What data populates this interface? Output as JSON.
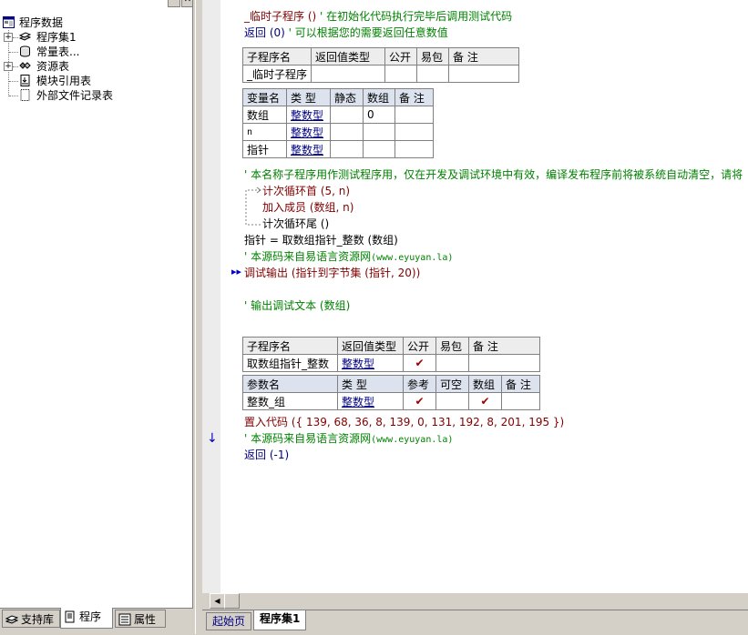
{
  "tree": {
    "root_label": "程序数据",
    "items": [
      {
        "label": "程序集1",
        "icon": "book-stack-icon",
        "expander": "+"
      },
      {
        "label": "常量表...",
        "icon": "database-icon",
        "expander": ""
      },
      {
        "label": "资源表",
        "icon": "resources-icon",
        "expander": "+"
      },
      {
        "label": "模块引用表",
        "icon": "module-ref-icon",
        "expander": ""
      },
      {
        "label": "外部文件记录表",
        "icon": "file-record-icon",
        "expander": ""
      }
    ]
  },
  "left_tabs": [
    {
      "label": "支持库",
      "icon": "library-icon"
    },
    {
      "label": "程序",
      "icon": "program-icon"
    },
    {
      "label": "属性",
      "icon": "properties-icon"
    }
  ],
  "code": {
    "line1_kw": "_临时子程序 ()",
    "line1_cm": "' 在初始化代码执行完毕后调用测试代码",
    "line2_kw": "返回 (0)",
    "line2_cm": "' 可以根据您的需要返回任意数值",
    "sub1_headers": [
      "子程序名",
      "返回值类型",
      "公开",
      "易包",
      "备 注"
    ],
    "sub1_row": [
      "_临时子程序",
      "",
      "",
      "",
      ""
    ],
    "var_headers": [
      "变量名",
      "类 型",
      "静态",
      "数组",
      "备 注"
    ],
    "vars": [
      {
        "name": "数组",
        "type": "整数型",
        "static": "",
        "array": "0",
        "note": ""
      },
      {
        "name": "n",
        "type": "整数型",
        "static": "",
        "array": "",
        "note": ""
      },
      {
        "name": "指针",
        "type": "整数型",
        "static": "",
        "array": "",
        "note": ""
      }
    ],
    "comment_long": "' 本名称子程序用作测试程序用，仅在开发及调试环境中有效，编译发布程序前将被系统自动清空，请将",
    "loop_head": "计次循环首 (5, n)",
    "loop_body": "加入成员 (数组, n)",
    "loop_tail": "计次循环尾 ()",
    "assign": "指针 = 取数组指针_整数 (数组)",
    "source_comment_prefix": "' 本源码来自易语言资源网",
    "source_comment_url": "(www.eyuyan.la)",
    "debug_output": "调试输出 (指针到字节集 (指针, 20))",
    "debug_text_comment": "' 输出调试文本 (数组)",
    "sub2_headers": [
      "子程序名",
      "返回值类型",
      "公开",
      "易包",
      "备 注"
    ],
    "sub2_row": {
      "name": "取数组指针_整数",
      "type": "整数型",
      "public": "✔",
      "epkg": "",
      "note": ""
    },
    "param_headers": [
      "参数名",
      "类 型",
      "参考",
      "可空",
      "数组",
      "备 注"
    ],
    "param_row": {
      "name": "整数_组",
      "type": "整数型",
      "ref": "✔",
      "nullable": "",
      "array": "✔",
      "note": ""
    },
    "embed_code": "置入代码 ({ 139, 68, 36, 8, 139, 0, 131, 192, 8, 201, 195 })",
    "source_comment2_prefix": "' 本源码来自易语言资源网",
    "source_comment2_url": "(www.eyuyan.la)",
    "return_neg": "返回 (-1)"
  },
  "doc_tabs": {
    "start": "起始页",
    "active": "程序集1"
  },
  "colors": {
    "keyword": "#800000",
    "comment": "#008000",
    "type": "#000080",
    "check": "#a00000"
  }
}
